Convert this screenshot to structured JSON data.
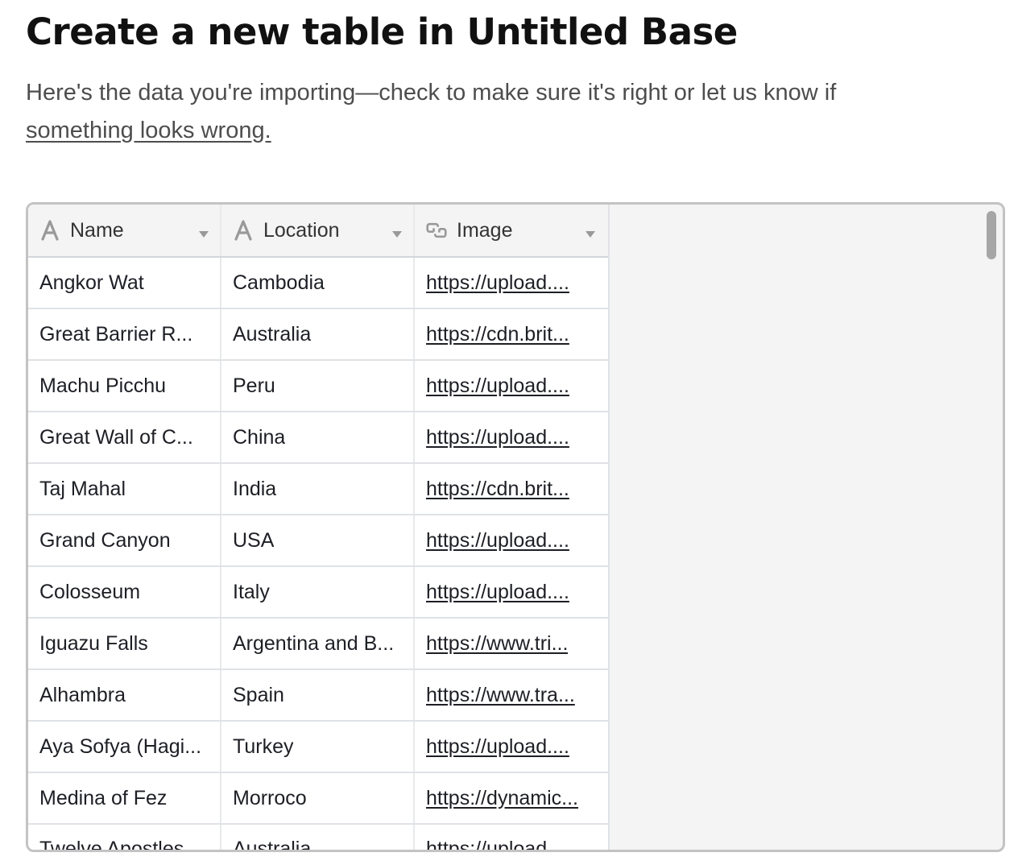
{
  "page": {
    "title": "Create a new table in Untitled Base",
    "subtitle_text": "Here's the data you're importing—check to make sure it's right or let us know if ",
    "subtitle_link": "something looks wrong."
  },
  "grid": {
    "columns": [
      {
        "label": "Name",
        "icon": "text-field-icon",
        "glyph": "A"
      },
      {
        "label": "Location",
        "icon": "text-field-icon",
        "glyph": "A"
      },
      {
        "label": "Image",
        "icon": "url-link-icon",
        "glyph": "link"
      }
    ],
    "rows": [
      {
        "name": "Angkor Wat",
        "location": "Cambodia",
        "image": "https://upload...."
      },
      {
        "name": "Great Barrier R...",
        "location": "Australia",
        "image": "https://cdn.brit..."
      },
      {
        "name": "Machu Picchu",
        "location": "Peru",
        "image": "https://upload...."
      },
      {
        "name": "Great Wall of C...",
        "location": "China",
        "image": "https://upload...."
      },
      {
        "name": "Taj Mahal",
        "location": "India",
        "image": "https://cdn.brit..."
      },
      {
        "name": "Grand Canyon",
        "location": "USA",
        "image": "https://upload...."
      },
      {
        "name": "Colosseum",
        "location": "Italy",
        "image": "https://upload...."
      },
      {
        "name": "Iguazu Falls",
        "location": "Argentina and B...",
        "image": "https://www.tri..."
      },
      {
        "name": "Alhambra",
        "location": "Spain",
        "image": "https://www.tra..."
      },
      {
        "name": "Aya Sofya (Hagi...",
        "location": "Turkey",
        "image": "https://upload...."
      },
      {
        "name": "Medina of Fez",
        "location": "Morroco",
        "image": "https://dynamic..."
      },
      {
        "name": "Twelve Apostles",
        "location": "Australia",
        "image": "https://upload...."
      }
    ]
  },
  "colors": {
    "frame_border": "#c3c3c3",
    "header_bg": "#f4f4f4",
    "empty_area_bg": "#f4f4f4",
    "icon_gray": "#999999",
    "scrollbar": "#a6a6a6"
  }
}
